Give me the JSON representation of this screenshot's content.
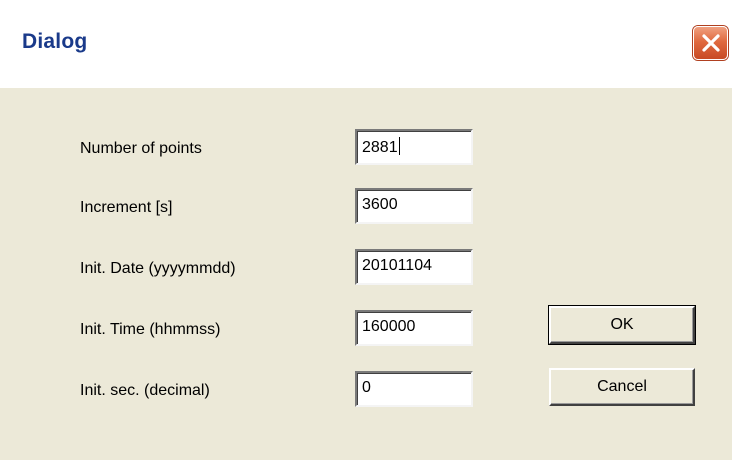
{
  "window": {
    "title": "Dialog",
    "close_icon": "close-icon"
  },
  "form": {
    "fields": [
      {
        "label": "Number of points",
        "value": "2881"
      },
      {
        "label": "Increment [s]",
        "value": "3600"
      },
      {
        "label": "Init. Date (yyyymmdd)",
        "value": "20101104"
      },
      {
        "label": "Init. Time (hhmmss)",
        "value": "160000"
      },
      {
        "label": "Init. sec. (decimal)",
        "value": "0"
      }
    ]
  },
  "buttons": {
    "ok_label": "OK",
    "cancel_label": "Cancel"
  },
  "colors": {
    "dialog_background": "#ece9d8",
    "title_text": "#1a3a8a",
    "close_button": "#e06a40"
  }
}
